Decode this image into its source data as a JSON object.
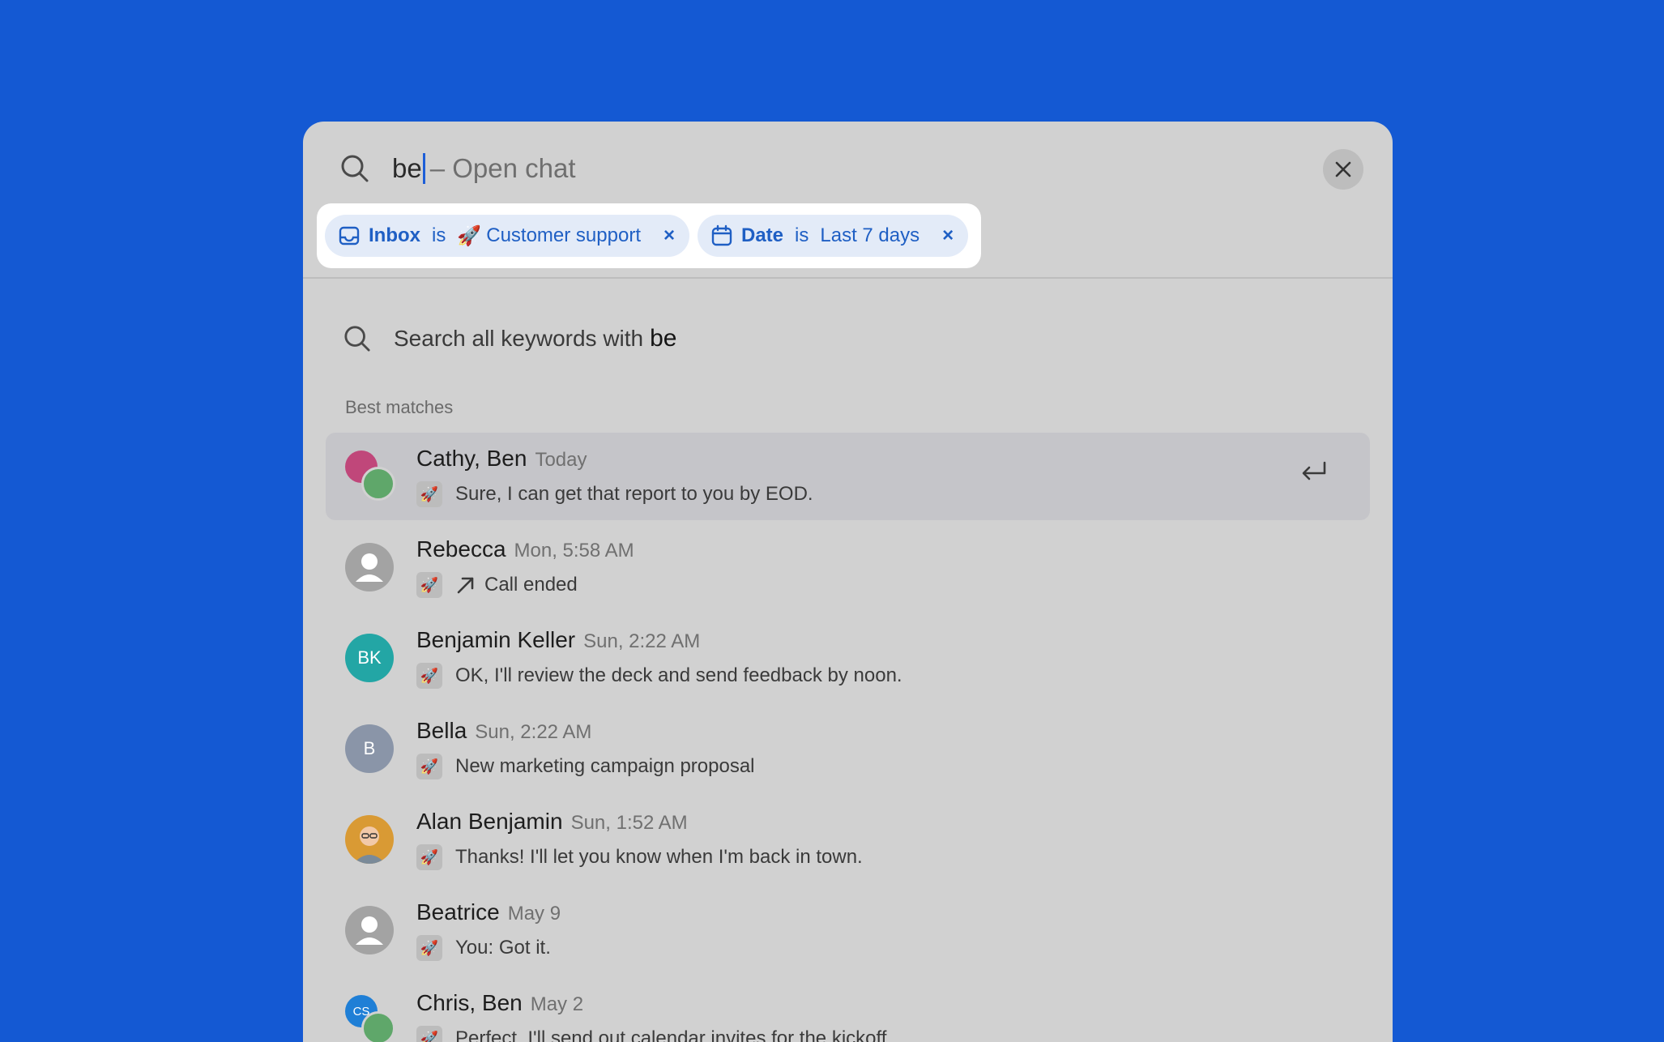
{
  "search": {
    "query": "be",
    "hint": "– Open chat"
  },
  "filters": [
    {
      "field": "Inbox",
      "op": "is",
      "value_icon": "🚀",
      "value": "Customer support",
      "remove": "×"
    },
    {
      "field": "Date",
      "op": "is",
      "value": "Last 7 days",
      "remove": "×"
    }
  ],
  "keywords": {
    "prefix": "Search all keywords with",
    "term": "be"
  },
  "section_label": "Best matches",
  "results": [
    {
      "name": "Cathy, Ben",
      "time": "Today",
      "inbox_icon": "🚀",
      "message": "Sure, I can get that report to you by EOD."
    },
    {
      "name": "Rebecca",
      "time": "Mon, 5:58 AM",
      "inbox_icon": "🚀",
      "message": "Call ended"
    },
    {
      "name": "Benjamin Keller",
      "time": "Sun, 2:22 AM",
      "inbox_icon": "🚀",
      "message": "OK, I'll review the deck and send feedback by noon.",
      "initials": "BK"
    },
    {
      "name": "Bella",
      "time": "Sun, 2:22 AM",
      "inbox_icon": "🚀",
      "message": "New marketing campaign proposal",
      "initials": "B"
    },
    {
      "name": "Alan Benjamin",
      "time": "Sun, 1:52 AM",
      "inbox_icon": "🚀",
      "message": "Thanks! I'll let you know when I'm back in town."
    },
    {
      "name": "Beatrice",
      "time": "May 9",
      "inbox_icon": "🚀",
      "message": "You: Got it."
    },
    {
      "name": "Chris, Ben",
      "time": "May 2",
      "inbox_icon": "🚀",
      "message": "Perfect, I'll send out calendar invites for the kickoff.",
      "initials": "CS"
    }
  ],
  "colors": {
    "background": "#1459d3",
    "panel": "#d1d1d1",
    "chip": "#e3ebf8",
    "accent": "#1f5fc4"
  }
}
